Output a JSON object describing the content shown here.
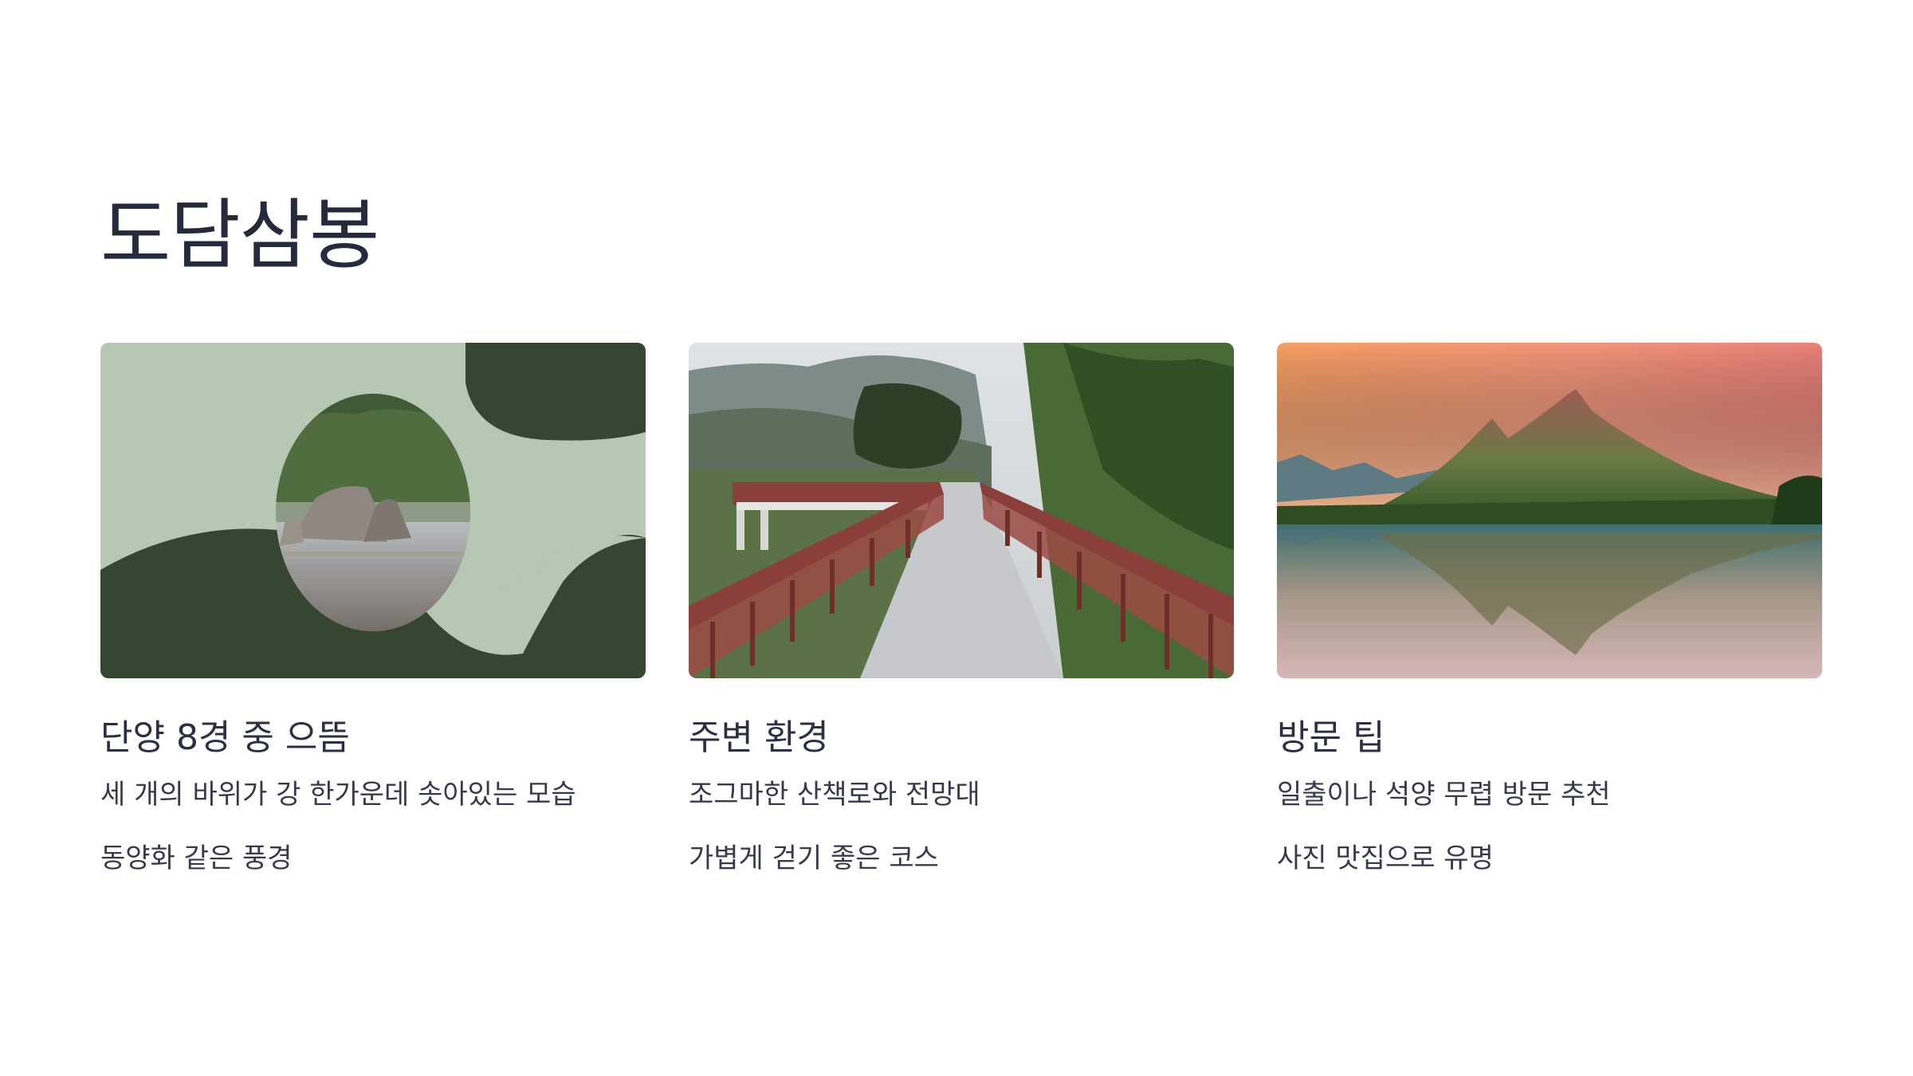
{
  "page": {
    "title": "도담삼봉"
  },
  "colors": {
    "title": "#262a3d",
    "text": "#363a4f",
    "sage": "#b6c7b3",
    "forest": "#374631",
    "rail": "#8a3f3a"
  },
  "cards": [
    {
      "title": "단양 8경 중 으뜸",
      "lines": [
        "세 개의 바위가 강 한가운데 솟아있는 모습",
        "동양화 같은 풍경"
      ],
      "image": "rocks-in-river-illustration"
    },
    {
      "title": "주변 환경",
      "lines": [
        "조그마한 산책로와 전망대",
        "가볍게 걷기 좋은 코스"
      ],
      "image": "wooden-bridge-walkway-photo"
    },
    {
      "title": "방문 팁",
      "lines": [
        "일출이나 석양 무렵 방문 추천",
        "사진 맛집으로 유명"
      ],
      "image": "mountain-lake-sunset-photo"
    }
  ]
}
